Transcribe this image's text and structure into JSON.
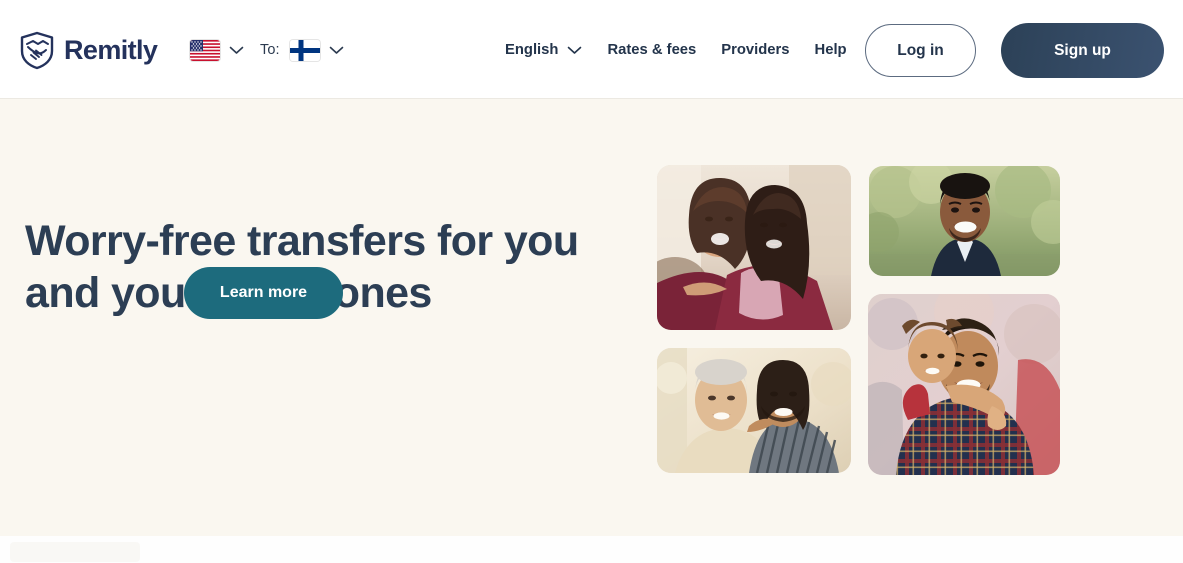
{
  "header": {
    "brand": {
      "name": "Remitly",
      "logo_icon": "shield-handshake-icon"
    },
    "corridor": {
      "from_flag_icon": "flag-united-states",
      "from_chevron_icon": "chevron-down-icon",
      "to_label": "To:",
      "to_flag_icon": "flag-finland",
      "to_chevron_icon": "chevron-down-icon"
    },
    "nav": [
      {
        "label": "English",
        "icon": "chevron-down-icon",
        "has_chevron": true
      },
      {
        "label": "Rates & fees",
        "has_chevron": false
      },
      {
        "label": "Providers",
        "has_chevron": false
      },
      {
        "label": "Help",
        "has_chevron": false
      }
    ],
    "auth": {
      "login_label": "Log in",
      "signup_label": "Sign up"
    }
  },
  "hero": {
    "title": "Worry-free transfers for you and your loved ones",
    "cta_label": "Learn more",
    "photos": [
      {
        "name": "photo-two-women-embracing",
        "alt": "Two smiling women embracing"
      },
      {
        "name": "photo-smiling-man-outdoors",
        "alt": "Smiling man outdoors with green trees behind"
      },
      {
        "name": "photo-elderly-woman-and-man",
        "alt": "Elderly woman smiling beside a man in a striped shirt"
      },
      {
        "name": "photo-man-with-girl-piggyback",
        "alt": "Man in plaid shirt carrying a young girl on his back"
      }
    ]
  },
  "colors": {
    "brand_navy": "#24325c",
    "heading_navy": "#2c3e54",
    "hero_background": "#faf7f0",
    "header_background": "#ffffff",
    "cta_teal": "#1d6b7d",
    "signup_navy": "#2c4157",
    "border": "#ece9e2"
  }
}
